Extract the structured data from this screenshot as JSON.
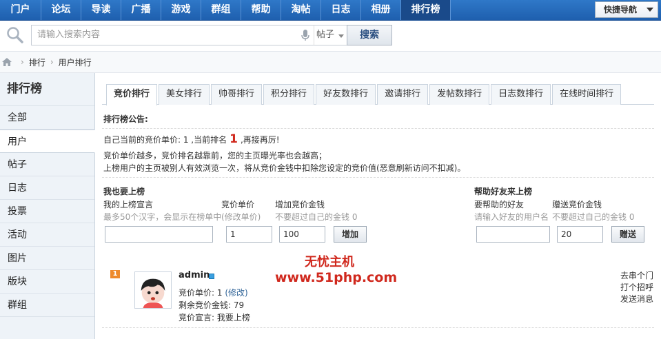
{
  "nav": {
    "items": [
      "门户",
      "论坛",
      "导读",
      "广播",
      "游戏",
      "群组",
      "帮助",
      "淘帖",
      "日志",
      "相册",
      "排行榜"
    ],
    "active_index": 10,
    "quick_nav_label": "快捷导航"
  },
  "search": {
    "placeholder": "请输入搜索内容",
    "type_label": "帖子",
    "button_label": "搜索"
  },
  "breadcrumb": [
    "排行",
    "用户排行"
  ],
  "sidebar": {
    "title": "排行榜",
    "items": [
      "全部",
      "用户",
      "帖子",
      "日志",
      "投票",
      "活动",
      "图片",
      "版块",
      "群组"
    ],
    "active_index": 1
  },
  "tabs": [
    "竞价排行",
    "美女排行",
    "帅哥排行",
    "积分排行",
    "好友数排行",
    "邀请排行",
    "发帖数排行",
    "日志数排行",
    "在线时间排行"
  ],
  "notice": {
    "title": "排行榜公告:",
    "line1_prefix": "自己当前的竞价单价: 1 ,当前排名",
    "rank": "1",
    "line1_suffix": ",再接再厉!",
    "line2": "竞价单价越多，竞价排名越靠前，您的主页曝光率也会越高；",
    "line3": "上榜用户的主页被别人有效浏览一次，将从竞价金钱中扣除您设定的竞价值(恶意刷新访问不扣减)。"
  },
  "self_form": {
    "title": "我也要上榜",
    "declaration_label": "我的上榜宣言",
    "declaration_hint": "最多50个汉字，会显示在榜单中",
    "price_label": "竞价单价",
    "price_hint": "(修改单价)",
    "price_value": "1",
    "money_label": "增加竞价金钱",
    "money_hint": "不要超过自己的金钱 0",
    "money_value": "100",
    "button_label": "增加"
  },
  "friend_form": {
    "title": "帮助好友来上榜",
    "friend_label": "要帮助的好友",
    "friend_hint": "请输入好友的用户名",
    "gift_label": "赠送竞价金钱",
    "gift_hint": "不要超过自己的金钱 0",
    "gift_value": "20",
    "button_label": "赠送"
  },
  "user_row": {
    "rank": "1",
    "username": "admin",
    "price_prefix": "竞价单价: 1 ",
    "price_link": "(修改)",
    "remaining": "剩余竞价金钱: 79",
    "declaration": "竞价宣言: 我要上榜",
    "actions": [
      "去串个门",
      "打个招呼",
      "发送消息"
    ]
  },
  "watermark": {
    "title": "无忧主机",
    "url": "www.51php.com"
  },
  "colors": {
    "nav_blue": "#2f78c8",
    "accent_red": "#d0281d"
  }
}
